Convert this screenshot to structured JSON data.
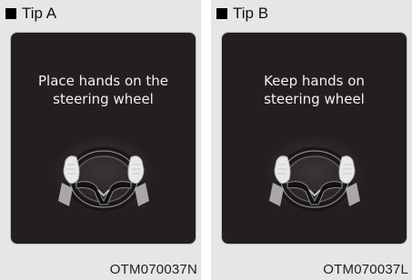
{
  "tips": [
    {
      "title": "Tip A",
      "message": "Place hands on the\nsteering wheel",
      "code": "OTM070037N"
    },
    {
      "title": "Tip B",
      "message": "Keep hands on\nsteering wheel",
      "code": "OTM070037L"
    }
  ],
  "colors": {
    "panel_bg": "#e6e6e6",
    "screen_bg": "#231f20",
    "screen_text": "#f2f2f2"
  },
  "icons": [
    "square-bullet-icon",
    "steering-wheel-with-hands-icon"
  ]
}
